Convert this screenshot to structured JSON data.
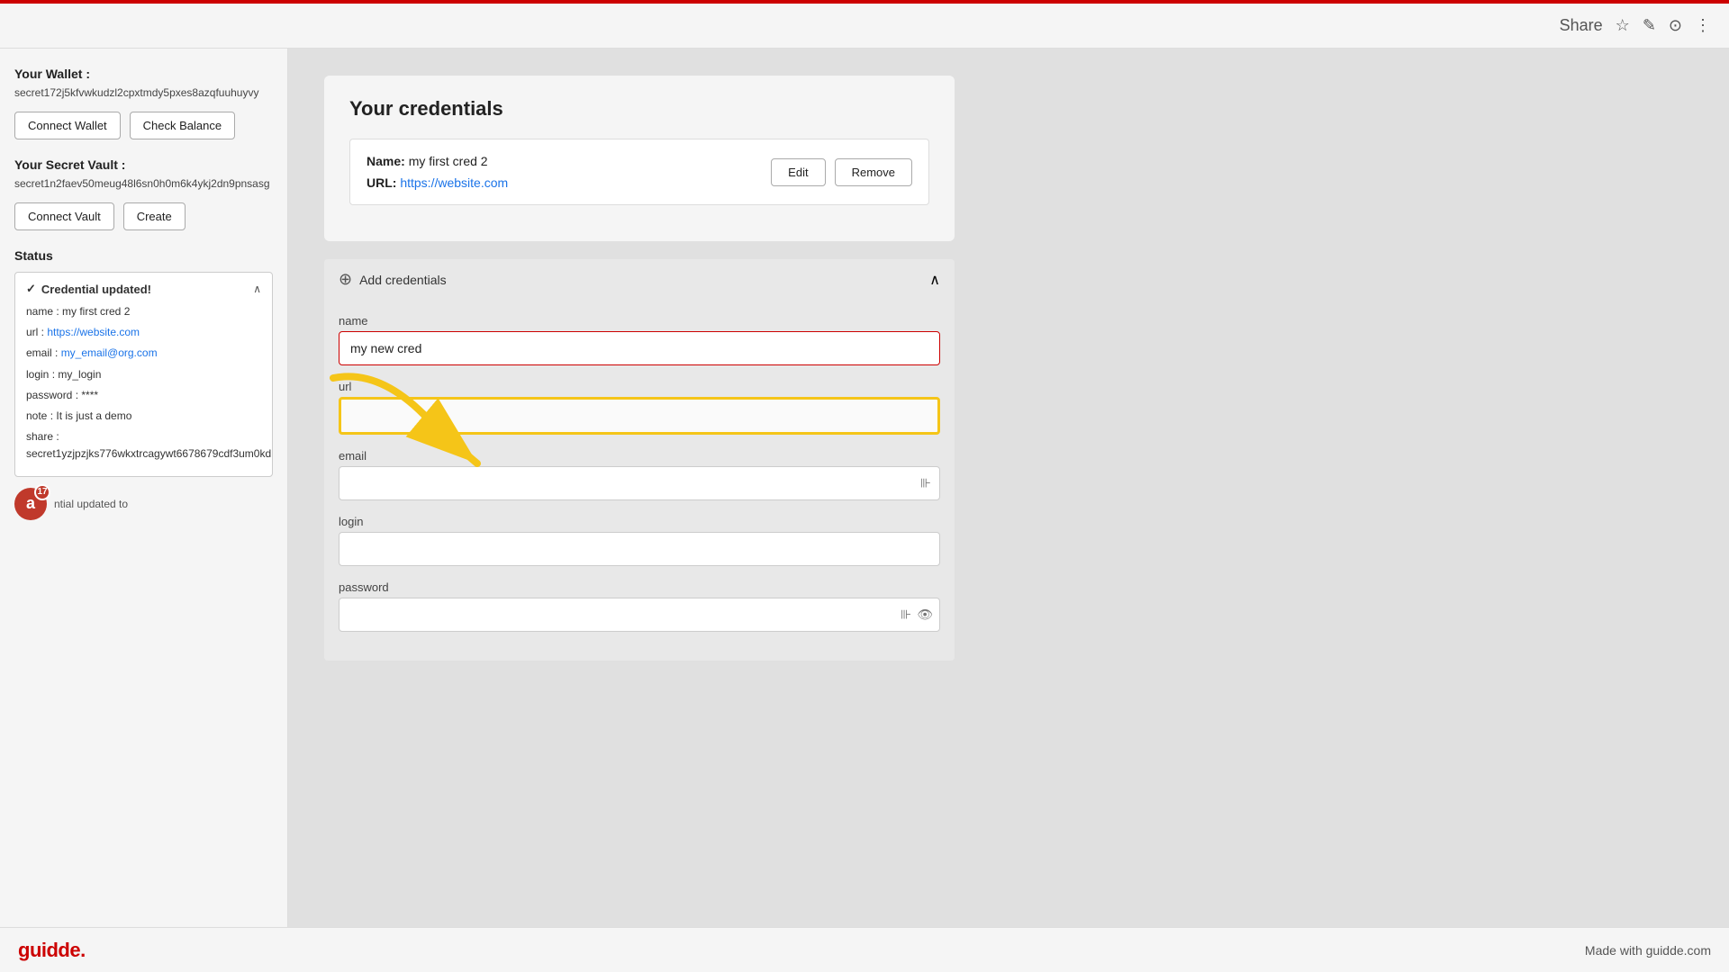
{
  "topbar": {
    "share_label": "Share"
  },
  "sidebar": {
    "wallet_label": "Your Wallet :",
    "wallet_value": "secret172j5kfvwkudzl2cpxtmdy5pxes8azqfuuhuyvy",
    "connect_wallet_label": "Connect Wallet",
    "check_balance_label": "Check Balance",
    "vault_label": "Your Secret Vault :",
    "vault_value": "secret1n2faev50meug48l6sn0h0m6k4ykj2dn9pnsasg",
    "connect_vault_label": "Connect Vault",
    "create_label": "Create",
    "status_label": "Status",
    "status_updated": "Credential updated!",
    "status_name": "name : my first cred 2",
    "status_url_label": "url : ",
    "status_url": "https://website.com",
    "status_email_label": "email : ",
    "status_email": "my_email@org.com",
    "status_login": "login : my_login",
    "status_password": "password : ****",
    "status_note": "note : It is just a demo",
    "status_share_label": "share :",
    "status_share_value": "secret1yzjpzjks776wkxtrcagywt6678679cdf3um0kd",
    "notif_count": "17",
    "notif_text": "ntial updated to"
  },
  "main": {
    "credentials_title": "Your credentials",
    "cred_name_label": "Name:",
    "cred_name_value": "my first cred 2",
    "cred_url_label": "URL:",
    "cred_url": "https://website.com",
    "edit_label": "Edit",
    "remove_label": "Remove",
    "add_cred_label": "Add credentials",
    "form": {
      "name_label": "name",
      "name_value": "my new cred",
      "url_label": "url",
      "url_value": "",
      "email_label": "email",
      "email_value": "",
      "login_label": "login",
      "login_value": "",
      "password_label": "password",
      "password_value": ""
    }
  },
  "footer": {
    "logo": "guidde.",
    "tagline": "Made with guidde.com"
  }
}
